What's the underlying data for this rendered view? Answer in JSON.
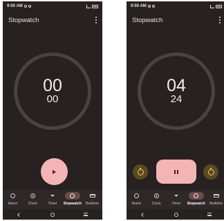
{
  "screens": [
    {
      "status_time": "9:50 AM",
      "title": "Stopwatch",
      "time_main": "00",
      "time_sub": "00",
      "state": "stopped"
    },
    {
      "status_time": "9:50 AM",
      "title": "Stopwatch",
      "time_main": "04",
      "time_sub": "24",
      "state": "running"
    }
  ],
  "nav": {
    "alarm": "Alarm",
    "clock": "Clock",
    "timer": "Timer",
    "stopwatch": "Stopwatch",
    "bedtime": "Bedtime"
  },
  "icons": {
    "play": "play-icon",
    "pause": "pause-icon",
    "reset": "reset-icon",
    "lap": "lap-icon",
    "menu": "kebab-menu-icon"
  },
  "colors": {
    "background": "#272121",
    "accent": "#f4b4b4",
    "secondary_button": "#5b4a1e",
    "active_tab": "#6b4a4a"
  }
}
